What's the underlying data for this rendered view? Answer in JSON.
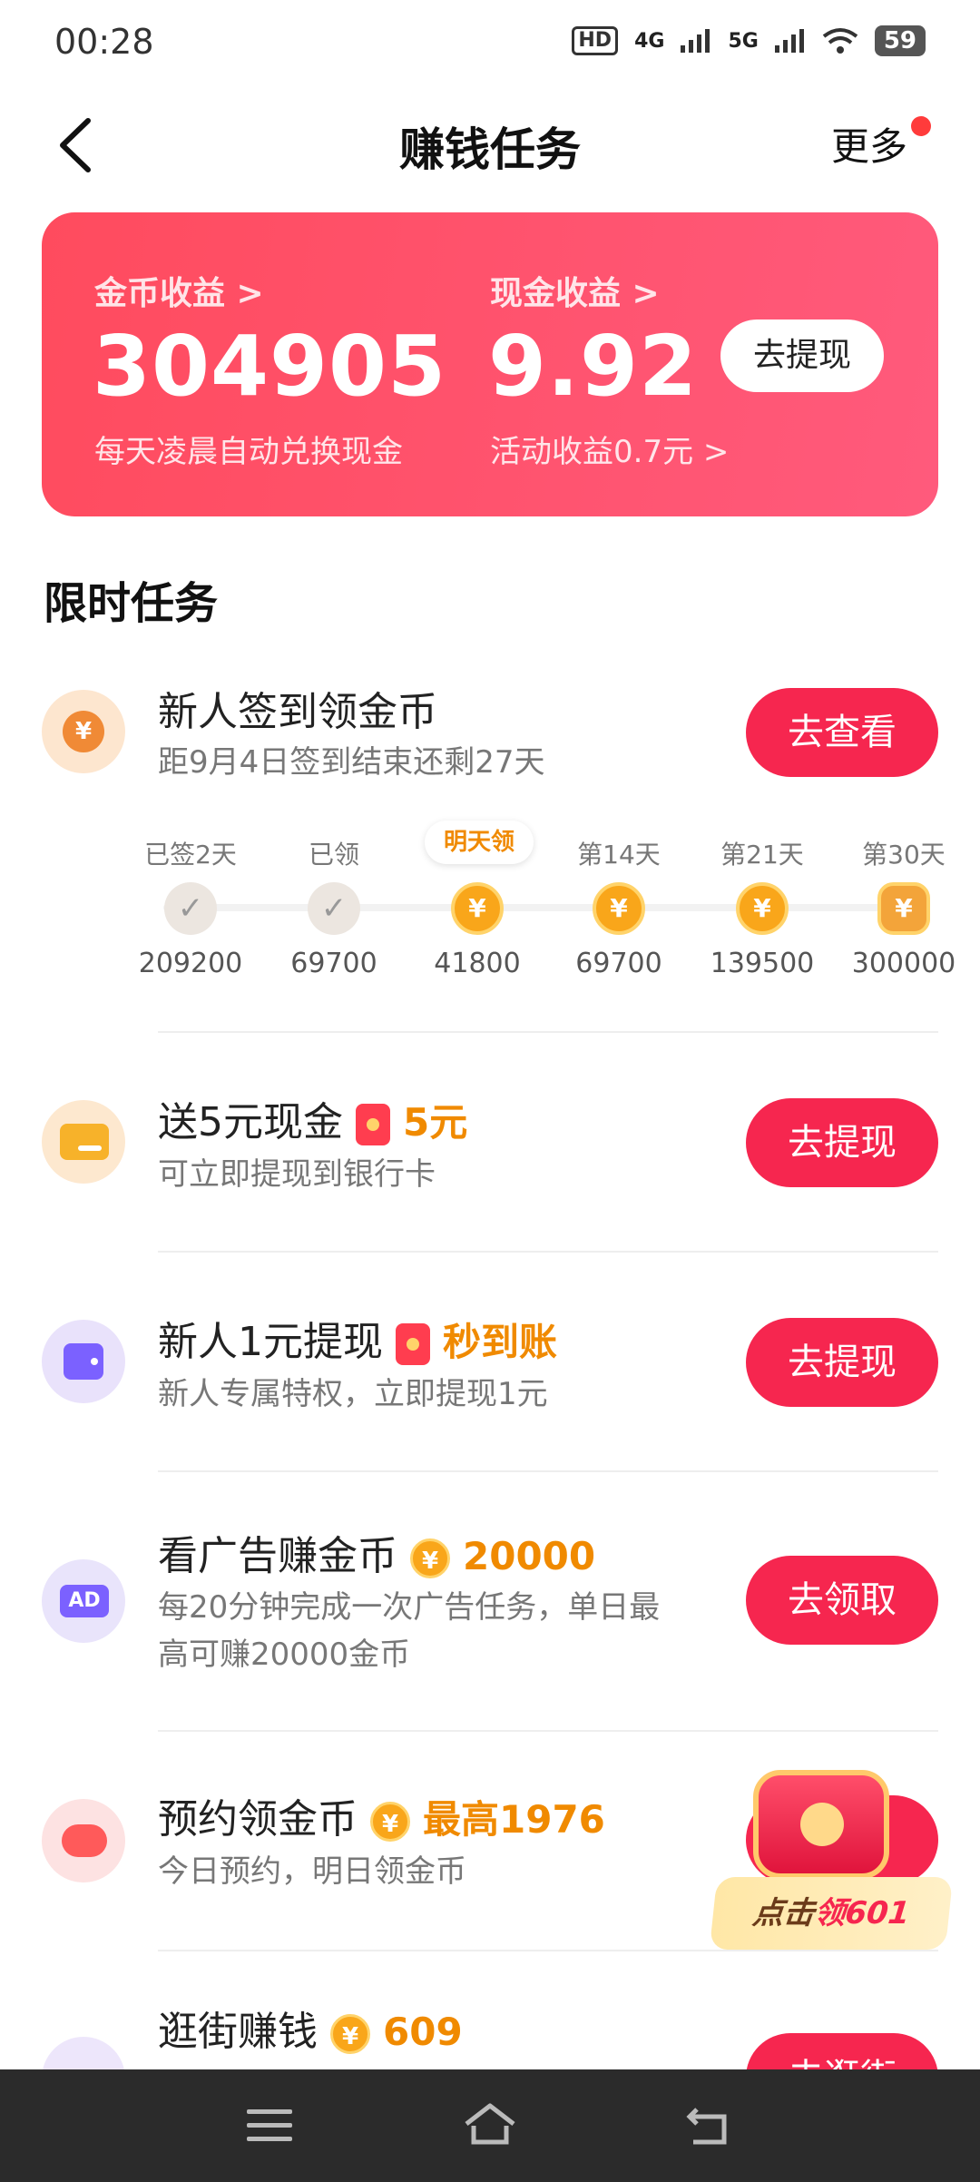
{
  "status_bar": {
    "time": "00:28",
    "hd": "HD",
    "net1": "4G",
    "net2": "5G",
    "battery": "59"
  },
  "header": {
    "title": "赚钱任务",
    "more": "更多"
  },
  "earnings": {
    "coin_label": "金币收益 >",
    "coin_value": "304905",
    "coin_sub": "每天凌晨自动兑换现金",
    "cash_label": "现金收益 >",
    "cash_value": "9.92",
    "cash_sub": "活动收益0.7元 >",
    "withdraw": "去提现"
  },
  "section_title": "限时任务",
  "signin": {
    "title": "新人签到领金币",
    "sub": "距9月4日签到结束还剩27天",
    "button": "去查看",
    "tomorrow_tag": "明天领",
    "steps": [
      {
        "label": "已签2天",
        "value": "209200",
        "state": "done"
      },
      {
        "label": "已领",
        "value": "69700",
        "state": "done"
      },
      {
        "label": "",
        "value": "41800",
        "state": "coin"
      },
      {
        "label": "第14天",
        "value": "69700",
        "state": "coin"
      },
      {
        "label": "第21天",
        "value": "139500",
        "state": "coin"
      },
      {
        "label": "第30天",
        "value": "300000",
        "state": "stack"
      }
    ]
  },
  "tasks": [
    {
      "title": "送5元现金",
      "highlight": "5元",
      "sub": "可立即提现到银行卡",
      "button": "去提现",
      "icon": "card-icon"
    },
    {
      "title": "新人1元提现",
      "highlight": "秒到账",
      "sub": "新人专属特权，立即提现1元",
      "button": "去提现",
      "icon": "wallet-icon"
    },
    {
      "title": "看广告赚金币",
      "highlight": "20000",
      "sub1": "每20分钟完成一次广告任务，单日最",
      "sub2": "高可赚20000金币",
      "button": "去领取",
      "icon": "ad-icon"
    },
    {
      "title": "预约领金币",
      "highlight": "最高1976",
      "sub": "今日预约，明日领金币",
      "button": "",
      "icon": "piggy-icon"
    },
    {
      "title": "逛街赚钱",
      "highlight": "609",
      "button": "去逛街",
      "icon": "shop-icon"
    }
  ],
  "floating": {
    "pre": "点击",
    "red": "领601"
  },
  "colors": {
    "accent": "#f6264f",
    "gold": "#f08a00",
    "card": "#ff4b5e"
  }
}
